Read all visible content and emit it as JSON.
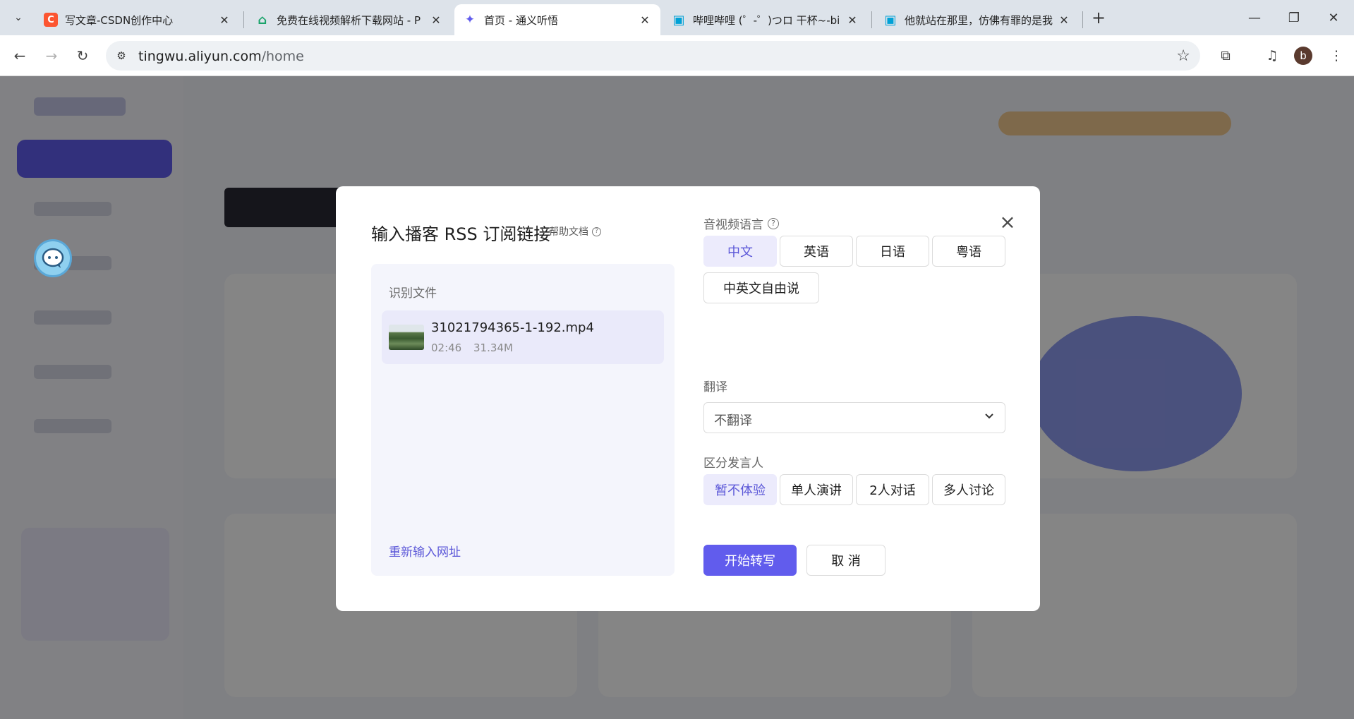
{
  "browser": {
    "tabs": [
      {
        "title": "写文章-CSDN创作中心",
        "favicon": "C",
        "favicon_color": "#fc5531"
      },
      {
        "title": "免费在线视频解析下载网站 - P",
        "favicon": "⌂",
        "favicon_color": "#1aa36b"
      },
      {
        "title": "首页 - 通义听悟",
        "favicon": "✦",
        "favicon_color": "#615ced"
      },
      {
        "title": "哔哩哔哩 (゜-゜)つロ 干杯~-bi",
        "favicon": "▣",
        "favicon_color": "#00a1d6"
      },
      {
        "title": "他就站在那里，仿佛有罪的是我",
        "favicon": "▣",
        "favicon_color": "#00a1d6"
      }
    ],
    "active_tab_index": 2,
    "url_host": "tingwu.aliyun.com",
    "url_path": "/home",
    "profile_initial": "b"
  },
  "modal": {
    "title": "输入播客 RSS 订阅链接",
    "help_label": "帮助文档",
    "help_icon": "?",
    "close_icon": "×",
    "file_panel": {
      "label": "识别文件",
      "file_name": "31021794365-1-192.mp4",
      "duration": "02:46",
      "size": "31.34M",
      "reinput_label": "重新输入网址"
    },
    "language": {
      "label": "音视频语言",
      "help_icon": "?",
      "options": [
        "中文",
        "英语",
        "日语",
        "粤语",
        "中英文自由说"
      ],
      "selected": "中文"
    },
    "translation": {
      "label": "翻译",
      "value": "不翻译"
    },
    "speaker": {
      "label": "区分发言人",
      "options": [
        "暂不体验",
        "单人演讲",
        "2人对话",
        "多人讨论"
      ],
      "selected": "暂不体验"
    },
    "start_button": "开始转写",
    "cancel_button": "取 消"
  },
  "colors": {
    "accent": "#615ced",
    "accent_light": "#ecebfc",
    "link": "#5b57d8"
  }
}
